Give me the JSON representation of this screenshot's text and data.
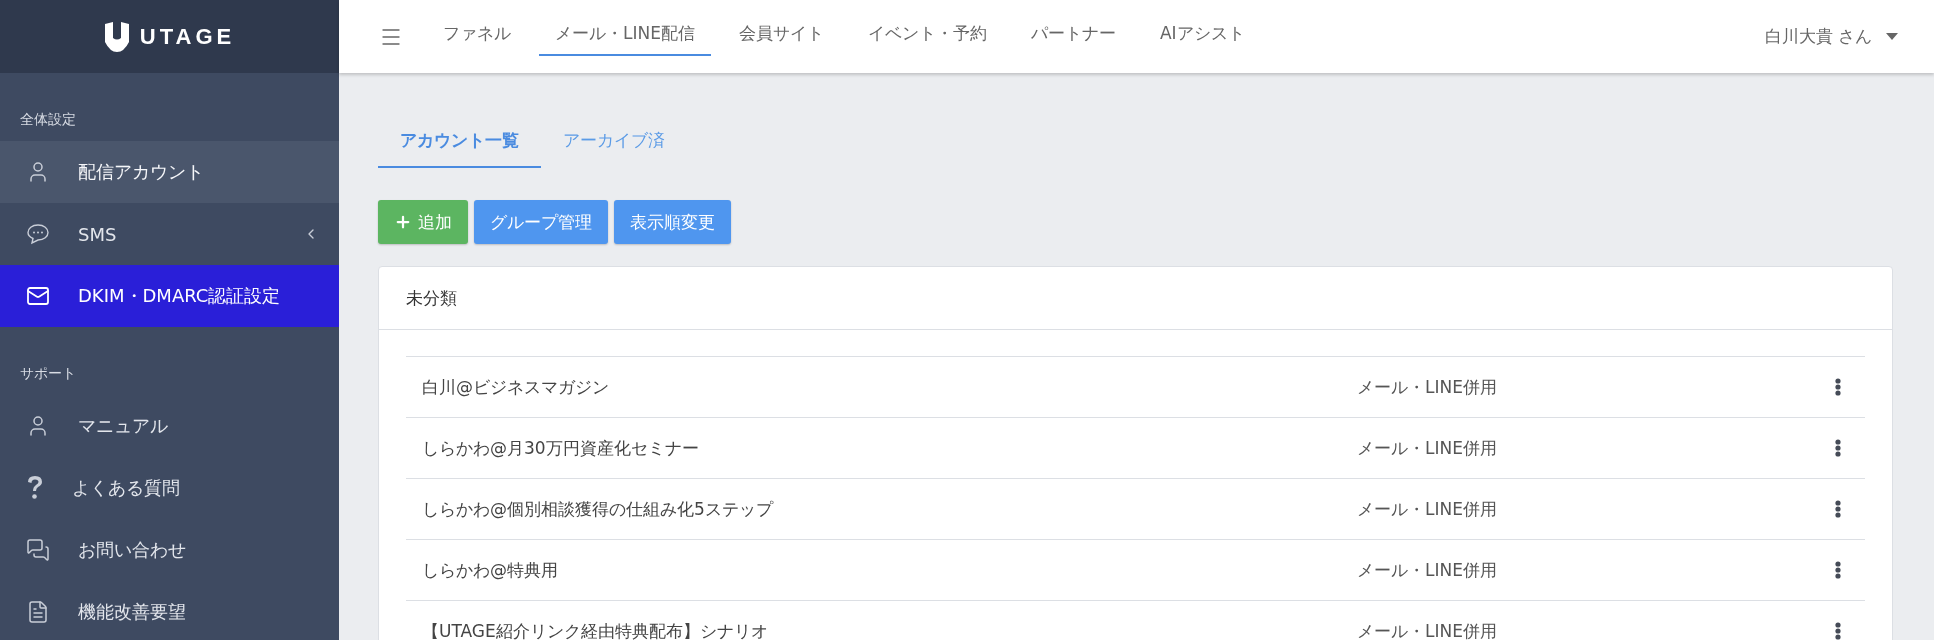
{
  "logo": {
    "text": "UTAGE"
  },
  "sidebar": {
    "groups": [
      {
        "title": "全体設定",
        "items": [
          {
            "label": "配信アカウント",
            "selected": false,
            "hovered": true,
            "has_submenu": false
          },
          {
            "label": "SMS",
            "selected": false,
            "hovered": false,
            "has_submenu": true
          },
          {
            "label": "DKIM・DMARC認証設定",
            "selected": true,
            "hovered": false,
            "has_submenu": false
          }
        ]
      },
      {
        "title": "サポート",
        "items": [
          {
            "label": "マニュアル",
            "selected": false,
            "hovered": false,
            "has_submenu": false
          },
          {
            "label": "よくある質問",
            "selected": false,
            "hovered": false,
            "has_submenu": false
          },
          {
            "label": "お問い合わせ",
            "selected": false,
            "hovered": false,
            "has_submenu": false
          },
          {
            "label": "機能改善要望",
            "selected": false,
            "hovered": false,
            "has_submenu": false
          }
        ]
      }
    ]
  },
  "topnav": {
    "items": [
      {
        "label": "ファネル",
        "selected": false
      },
      {
        "label": "メール・LINE配信",
        "selected": true
      },
      {
        "label": "会員サイト",
        "selected": false
      },
      {
        "label": "イベント・予約",
        "selected": false
      },
      {
        "label": "パートナー",
        "selected": false
      },
      {
        "label": "AIアシスト",
        "selected": false
      }
    ],
    "user": "白川大貴 さん"
  },
  "tabs": [
    {
      "label": "アカウント一覧",
      "selected": true
    },
    {
      "label": "アーカイブ済",
      "selected": false
    }
  ],
  "buttons": [
    {
      "kind": "add",
      "label": "追加"
    },
    {
      "kind": "primary",
      "label": "グループ管理"
    },
    {
      "kind": "primary",
      "label": "表示順変更"
    }
  ],
  "group": {
    "title": "未分類",
    "rows": [
      {
        "name": "白川@ビジネスマガジン",
        "type": "メール・LINE併用"
      },
      {
        "name": "しらかわ@月30万円資産化セミナー",
        "type": "メール・LINE併用"
      },
      {
        "name": "しらかわ@個別相談獲得の仕組み化5ステップ",
        "type": "メール・LINE併用"
      },
      {
        "name": "しらかわ@特典用",
        "type": "メール・LINE併用"
      },
      {
        "name": "【UTAGE紹介リンク経由特典配布】シナリオ",
        "type": "メール・LINE併用"
      }
    ]
  }
}
